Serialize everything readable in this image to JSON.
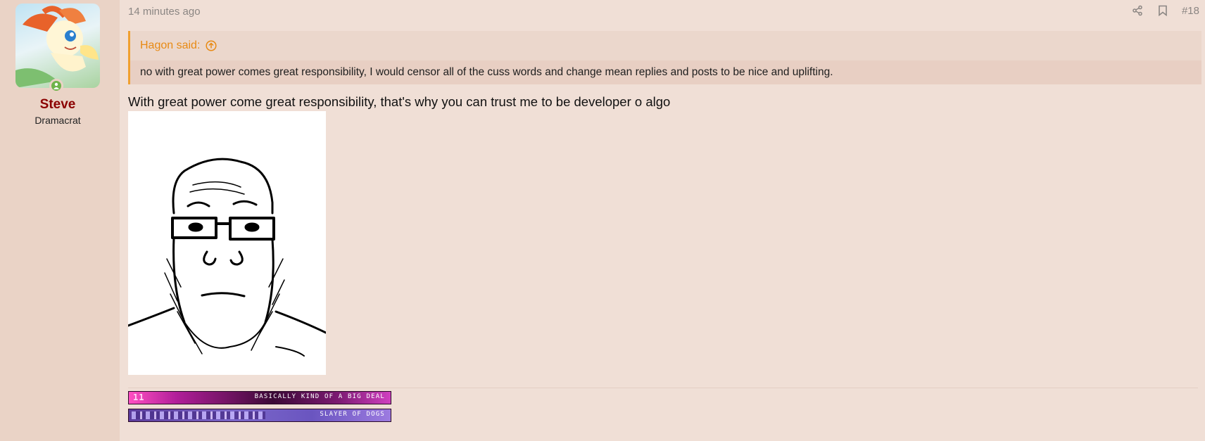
{
  "user": {
    "name": "Steve",
    "title": "Dramacrat"
  },
  "post": {
    "timestamp": "14 minutes ago",
    "number": "#18",
    "quote": {
      "author_label": "Hagon said:",
      "text": "no with great power comes great responsibility, I would censor all of the cuss words and change mean replies and posts to be nice and uplifting."
    },
    "body": "With great power come great responsibility, that's why you can trust me to be developer o algo"
  },
  "banners": [
    {
      "badge": "11",
      "text": "BASICALLY KIND OF A BIG DEAL"
    },
    {
      "text": "SLAYER OF DOGS"
    }
  ],
  "icons": {
    "share": "share-icon",
    "bookmark": "bookmark-icon",
    "quote_jump": "arrow-up-circle-icon",
    "online": "user-icon"
  },
  "colors": {
    "username": "#8b0000",
    "quote_accent": "#f0a030",
    "online": "#6fb34a"
  }
}
